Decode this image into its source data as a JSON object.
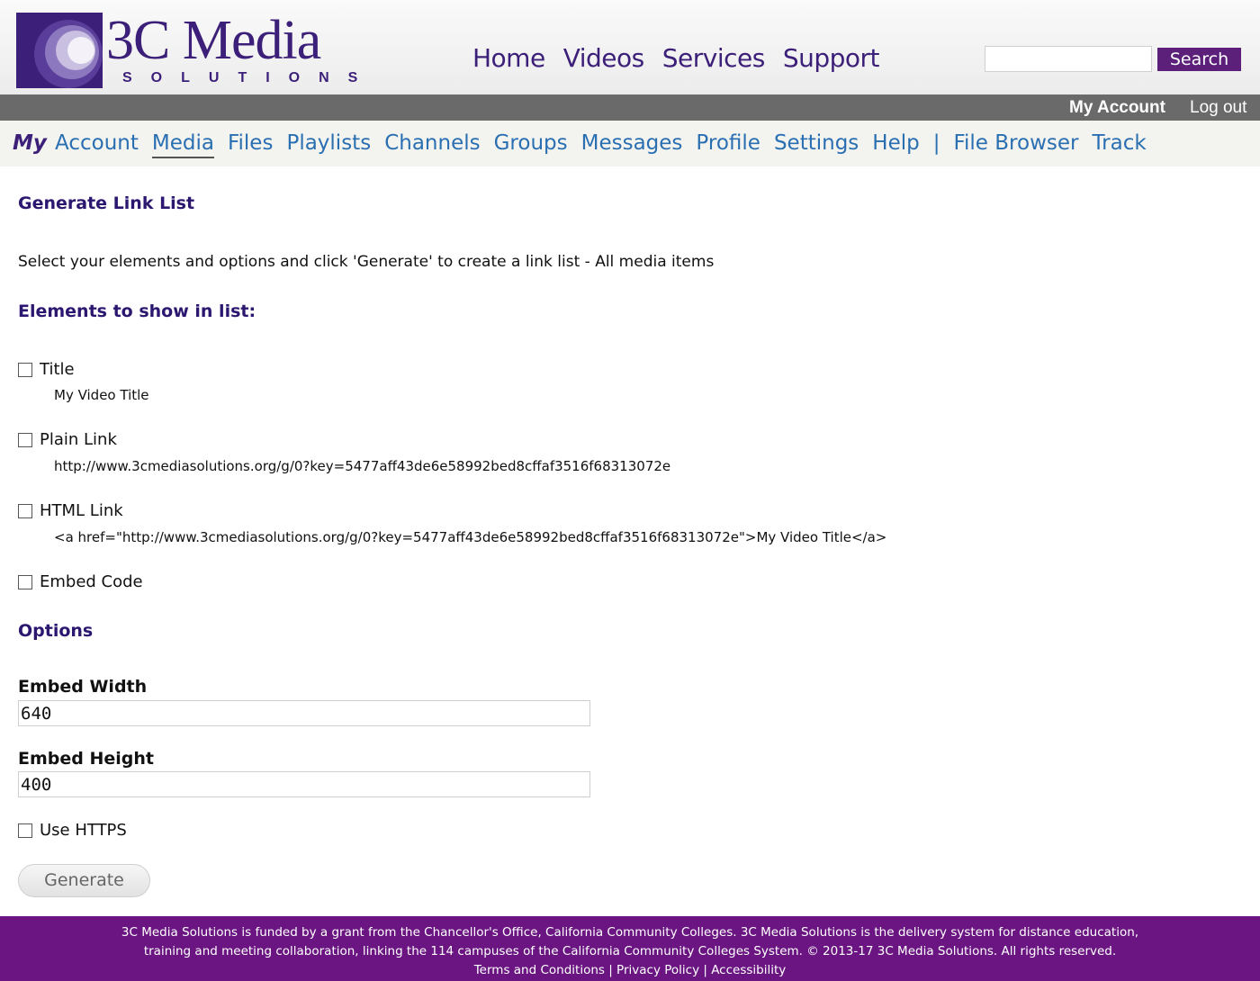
{
  "header": {
    "logo_word": "3C Media",
    "logo_sub": "SOLUTIONS",
    "nav": [
      "Home",
      "Videos",
      "Services",
      "Support"
    ],
    "search_button": "Search",
    "search_value": ""
  },
  "account_bar": {
    "my_account": "My Account",
    "log_out": "Log out"
  },
  "sub_nav": {
    "my": "My",
    "items": [
      "Account",
      "Media",
      "Files",
      "Playlists",
      "Channels",
      "Groups",
      "Messages",
      "Profile",
      "Settings",
      "Help",
      "|",
      "File Browser",
      "Track"
    ],
    "active": "Media"
  },
  "content": {
    "title": "Generate Link List",
    "intro": "Select your elements and options and click 'Generate' to create a link list - All media items",
    "elements_heading": "Elements to show in list:",
    "elements": [
      {
        "label": "Title",
        "sample": "My Video Title",
        "checked": false
      },
      {
        "label": "Plain Link",
        "sample": "http://www.3cmediasolutions.org/g/0?key=5477aff43de6e58992bed8cffaf3516f68313072e",
        "checked": false
      },
      {
        "label": "HTML Link",
        "sample": "<a href=\"http://www.3cmediasolutions.org/g/0?key=5477aff43de6e58992bed8cffaf3516f68313072e\">My Video Title</a>",
        "checked": false
      },
      {
        "label": "Embed Code",
        "sample": "",
        "checked": false
      }
    ],
    "options_heading": "Options",
    "embed_width_label": "Embed Width",
    "embed_width_value": "640",
    "embed_height_label": "Embed Height",
    "embed_height_value": "400",
    "use_https_label": "Use HTTPS",
    "use_https_checked": false,
    "generate_button": "Generate"
  },
  "footer": {
    "line1": "3C Media Solutions is funded by a grant from the Chancellor's Office, California Community Colleges. 3C Media Solutions is the delivery system for distance education,",
    "line2": "training and meeting collaboration, linking the 114 campuses of the California Community Colleges System. © 2013-17 3C Media Solutions. All rights reserved.",
    "line3": "Terms and Conditions | Privacy Policy | Accessibility"
  },
  "colors": {
    "brand_purple": "#3b1f78",
    "search_button_bg": "#5c1f7a",
    "account_bar_bg": "#6a6a6a",
    "link_blue": "#2a6fb2",
    "footer_bg": "#6a1581"
  }
}
